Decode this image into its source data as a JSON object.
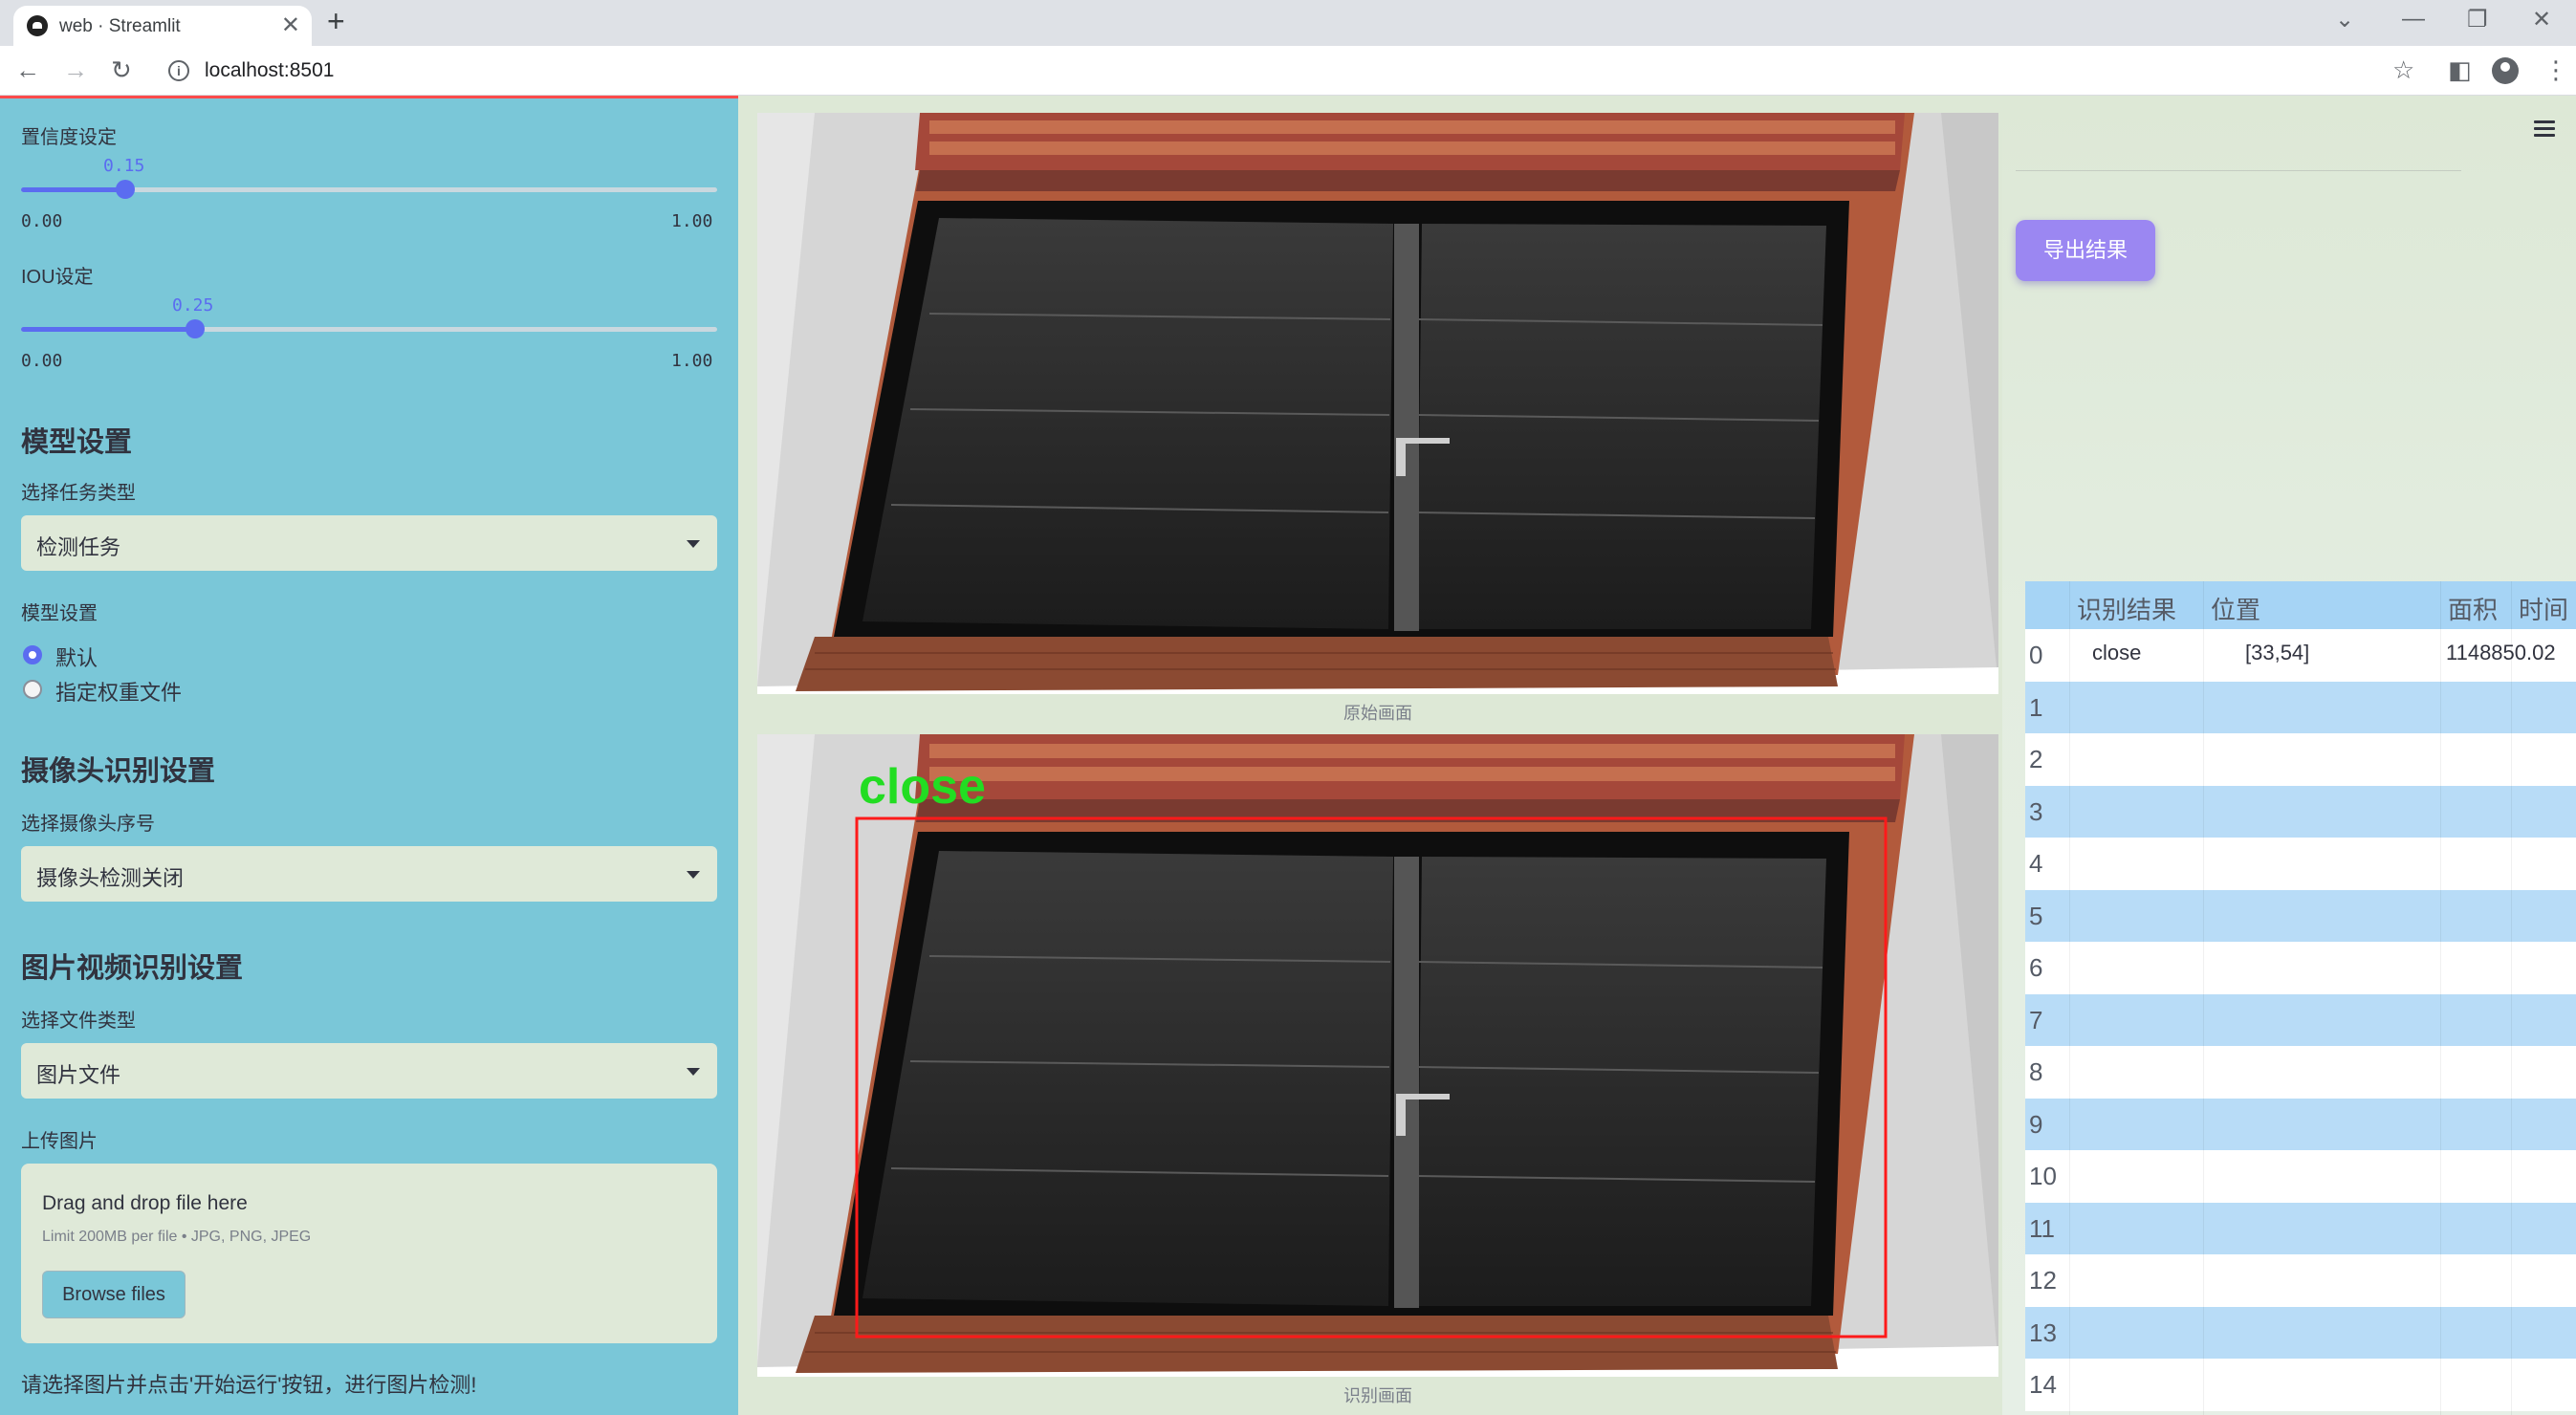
{
  "browser": {
    "tab_title": "web · Streamlit",
    "url": "localhost:8501"
  },
  "sidebar": {
    "confidence": {
      "label": "置信度设定",
      "value": "0.15",
      "value_num": 0.15,
      "min": "0.00",
      "max": "1.00"
    },
    "iou": {
      "label": "IOU设定",
      "value": "0.25",
      "value_num": 0.25,
      "min": "0.00",
      "max": "1.00"
    },
    "model_section": {
      "heading": "模型设置",
      "task_label": "选择任务类型",
      "task_value": "检测任务",
      "model_label": "模型设置",
      "options": [
        "默认",
        "指定权重文件"
      ],
      "selected": "默认"
    },
    "camera_section": {
      "heading": "摄像头识别设置",
      "cam_label": "选择摄像头序号",
      "cam_value": "摄像头检测关闭"
    },
    "file_section": {
      "heading": "图片视频识别设置",
      "type_label": "选择文件类型",
      "type_value": "图片文件",
      "upload_label": "上传图片",
      "drop_text": "Drag and drop file here",
      "limit_text": "Limit 200MB per file • JPG, PNG, JPEG",
      "browse_label": "Browse files"
    },
    "hint": "请选择图片并点击'开始运行'按钮，进行图片检测!"
  },
  "main": {
    "original_caption": "原始画面",
    "result_caption": "识别画面",
    "detection_label": "close",
    "colors": {
      "box": "#ff1a1a",
      "label": "#22dd22"
    }
  },
  "right_panel": {
    "export_label": "导出结果",
    "table": {
      "headers": [
        "识别结果",
        "位置",
        "面积",
        "时间"
      ],
      "row_indices": [
        "0",
        "1",
        "2",
        "3",
        "4",
        "5",
        "6",
        "7",
        "8",
        "9",
        "10",
        "11",
        "12",
        "13",
        "14"
      ],
      "rows": [
        {
          "result": "close",
          "position": "[33,54]",
          "area": "1148850.02",
          "time": ""
        }
      ]
    }
  }
}
